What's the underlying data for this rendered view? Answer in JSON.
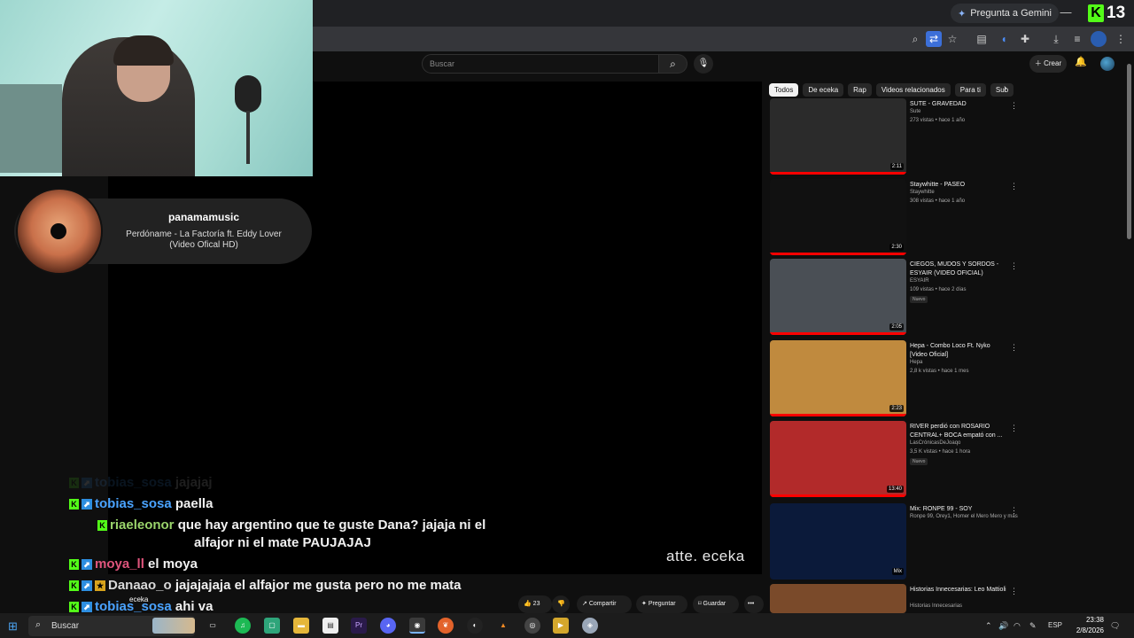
{
  "browser": {
    "gemini_label": "Pregunta a Gemini",
    "window_controls": [
      "—",
      "□",
      "✕"
    ]
  },
  "kick": {
    "viewer_count": "13"
  },
  "youtube": {
    "search_placeholder": "Buscar",
    "create_label": "Crear",
    "chips": [
      "Todos",
      "De eceka",
      "Rap",
      "Videos relacionados",
      "Para ti",
      "Sub"
    ],
    "recommendations": [
      {
        "title": "SUTE - GRAVEDAD",
        "channel": "Sute",
        "meta": "273 vistas • hace 1 año",
        "duration": "2:11",
        "badge": "",
        "thumb_bg": "#2b2b2b"
      },
      {
        "title": "Staywhitte - PASEO",
        "channel": "Staywhitte",
        "meta": "308 vistas • hace 1 año",
        "duration": "2:30",
        "badge": "",
        "thumb_bg": "#111"
      },
      {
        "title": "CIEGOS, MUDOS Y SORDOS - ESYAIR (VIDEO OFICIAL)",
        "channel": "ESYAIR",
        "meta": "109 vistas • hace 2 días",
        "duration": "2:05",
        "badge": "Nuevo",
        "thumb_bg": "#4a4f55"
      },
      {
        "title": "Hepa - Combo Loco Ft. Nyko [Video Oficial]",
        "channel": "Hepa",
        "meta": "2,8 k vistas • hace 1 mes",
        "duration": "2:23",
        "badge": "",
        "thumb_bg": "#c08a3e"
      },
      {
        "title": "RIVER perdió con ROSARIO CENTRAL+ BOCA empató con ...",
        "channel": "LasCrónicasDeJoaqo",
        "meta": "3,5 K vistas • hace 1 hora",
        "duration": "13:40",
        "badge": "Nuevo",
        "thumb_bg": "#b22a2a"
      },
      {
        "title": "Mix: RONPE 99 - SOY",
        "channel": "Ronpe 99, Orey1, Homer el Mero Mero y más",
        "meta": "",
        "duration": "Mix",
        "badge": "",
        "thumb_bg": "#0b1a3a"
      },
      {
        "title": "Historias Innecesarias: Leo Mattioli",
        "channel": "Historias Innecesarias",
        "meta": "",
        "duration": "",
        "badge": "",
        "thumb_bg": "#7a4a2a"
      }
    ],
    "actions": {
      "likes": "23",
      "share": "Compartir",
      "ask": "Preguntar",
      "save": "Guardar",
      "more": "•••"
    }
  },
  "video": {
    "watermark": "atte. eceka"
  },
  "now_playing": {
    "user": "panamamusic",
    "track": "Perdóname - La Factoría ft. Eddy Lover (Video Ofical HD)"
  },
  "chat": [
    {
      "user": "tobias_sosa",
      "user_color": "#4aa3ff",
      "text": "jajajaj",
      "faded": true,
      "badges": [
        "k",
        "up"
      ]
    },
    {
      "user": "tobias_sosa",
      "user_color": "#4aa3ff",
      "text": "paella",
      "faded": false,
      "badges": [
        "k",
        "up"
      ]
    },
    {
      "user": "riaeleonor",
      "user_color": "#9ad46b",
      "text": "que hay argentino que te guste Dana? jajaja ni el",
      "text2": "alfajor ni el mate PAUJAJAJ",
      "faded": false,
      "badges": [
        "k"
      ]
    },
    {
      "user": "moya_ll",
      "user_color": "#e0557d",
      "text": "el moya",
      "faded": false,
      "badges": [
        "k",
        "up"
      ]
    },
    {
      "user": "Danaao_o",
      "user_color": "#d9d9d9",
      "text": "jajajajaja el alfajor me gusta pero no me mata",
      "faded": false,
      "badges": [
        "k",
        "up",
        "gold"
      ]
    },
    {
      "user": "tobias_sosa",
      "user_color": "#4aa3ff",
      "text": "ahi va",
      "faded": false,
      "badges": [
        "k",
        "up"
      ]
    }
  ],
  "chat_overlay_label": "eceka",
  "taskbar": {
    "search_label": "Buscar",
    "language": "ESP",
    "time": "23:38",
    "date": "2/8/2026"
  }
}
